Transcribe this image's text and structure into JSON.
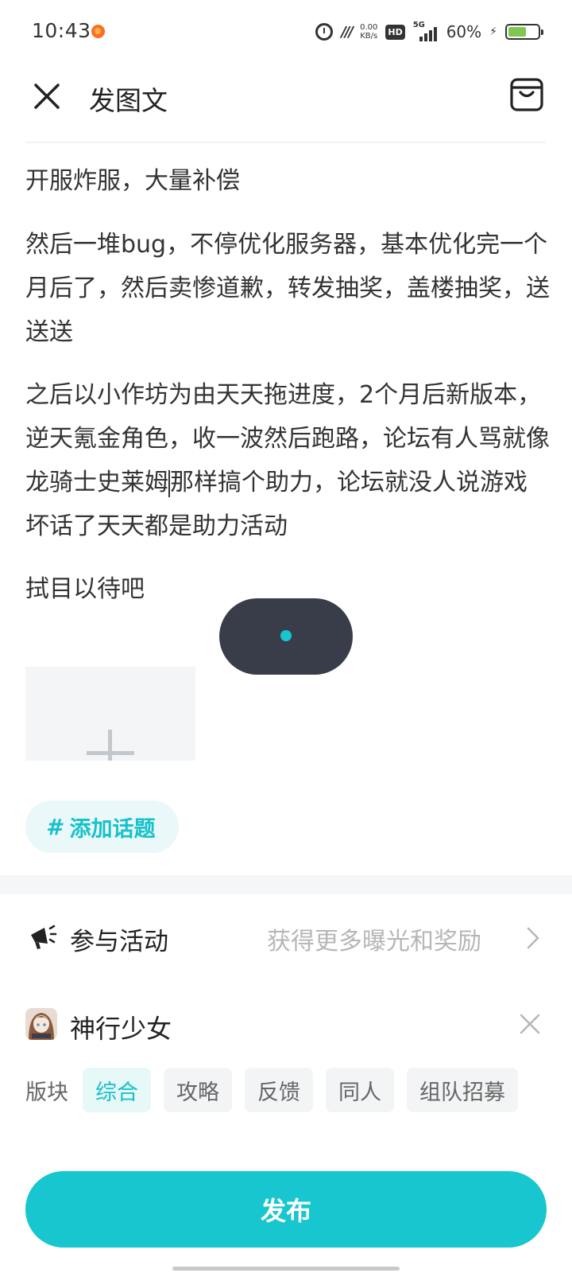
{
  "status_bar": {
    "time": "10:43",
    "net_speed_value": "0.00",
    "net_speed_unit": "KB/s",
    "hd_label": "HD",
    "signal_label": "5G",
    "battery_percent": "60%",
    "battery_level": 0.6,
    "battery_color": "#7fc850"
  },
  "header": {
    "title": "发图文",
    "close_icon": "close-icon",
    "drafts_icon": "drafts-bag-icon"
  },
  "post": {
    "paragraphs": [
      "开服炸服，大量补偿",
      "然后一堆bug，不停优化服务器，基本优化完一个月后了，然后卖惨道歉，转发抽奖，盖楼抽奖，送送送",
      "之后以小作坊为由天天拖进度，2个月后新版本，逆天氪金角色，收一波然后跑路，论坛有人骂就像龙骑士史莱姆",
      "拭目以待吧"
    ],
    "paragraph_3_after_cursor": "那样搞个助力，论坛就没人说游戏坏话了天天都是助力活动"
  },
  "topic": {
    "hash": "#",
    "label": "添加话题"
  },
  "activity": {
    "label": "参与活动",
    "hint": "获得更多曝光和奖励"
  },
  "game": {
    "name": "神行少女"
  },
  "board": {
    "label": "版块",
    "options": [
      "综合",
      "攻略",
      "反馈",
      "同人",
      "组队招募"
    ],
    "selected": "综合"
  },
  "publish": {
    "label": "发布"
  },
  "colors": {
    "accent": "#17c6cf",
    "accent_text": "#17c1ca",
    "loading_pill": "#393d4a"
  }
}
